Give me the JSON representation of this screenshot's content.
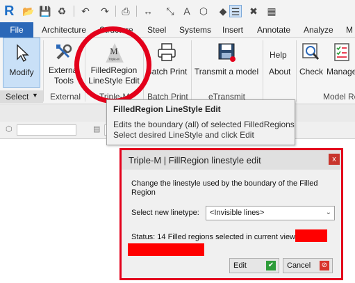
{
  "qat": {
    "logo": "R",
    "icons": [
      "open-icon",
      "save-icon",
      "sync-icon",
      "undo-icon",
      "redo-icon",
      "print-icon",
      "measure-icon",
      "dimension-icon",
      "text-icon",
      "view-3d-icon",
      "tag-icon",
      "switch-windows-icon",
      "close-inactive-icon",
      "window-icon"
    ]
  },
  "tabs": [
    "File",
    "Architecture",
    "Structure",
    "Steel",
    "Systems",
    "Insert",
    "Annotate",
    "Analyze",
    "M"
  ],
  "ribbon": {
    "modify": "Modify",
    "select": "Select",
    "external_tools": [
      "External",
      "Tools"
    ],
    "filledregion": [
      "FilledRegion",
      "LineStyle Edit"
    ],
    "filledregion_icon_text": "Triple-M",
    "batch_print": "Batch Print",
    "transmit": "Transmit a model",
    "help": "Help",
    "about": "About",
    "check": "Check",
    "manage": "Manage",
    "panels": {
      "external": "External",
      "triple_m": "Triple-M",
      "batch_print": "Batch Print",
      "etransmit": "eTransmit",
      "model_re": "Model Re"
    }
  },
  "tooltip": {
    "title": "FilledRegion LineStyle Edit",
    "line1": "Edits the boundary (all) of selected FilledRegions",
    "line2": "Select desired LineStyle and click Edit"
  },
  "dialog": {
    "title": "Triple-M | FillRegion linestyle edit",
    "close": "x",
    "desc_line1": "Change the linestyle used by the boundary of the Filled",
    "desc_line2": "Region",
    "select_label": "Select new linetype:",
    "select_value": "<Invisible lines>",
    "status": "Status: 14 Filled regions selected in current view:",
    "edit_button": "Edit",
    "cancel_button": "Cancel"
  },
  "colors": {
    "accent_blue": "#2b68b8",
    "highlight_red": "#e3001b",
    "redaction": "#ff0000"
  }
}
